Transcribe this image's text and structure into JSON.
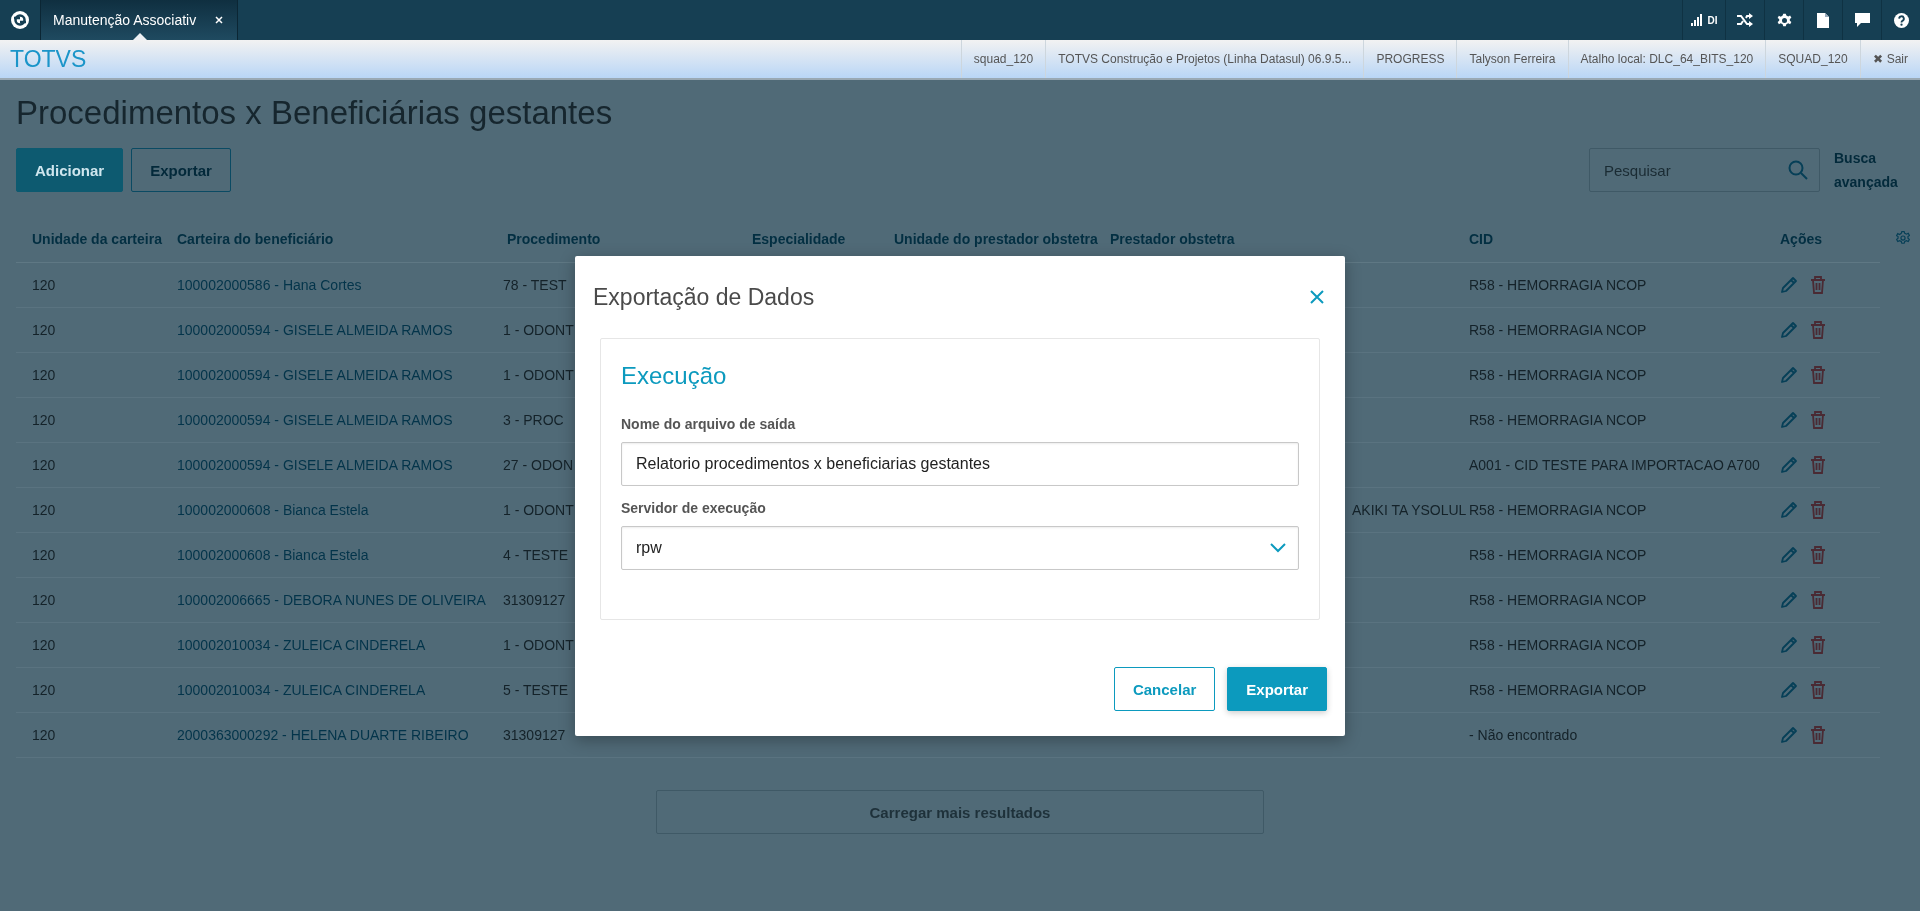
{
  "top_bar": {
    "tabs": [
      {
        "label": "Manutenção Associativ",
        "selected": true
      }
    ],
    "signal_label": "DI"
  },
  "header": {
    "brand": "TOTVS",
    "info": [
      "squad_120",
      "TOTVS Construção e Projetos (Linha Datasul) 06.9.5...",
      "PROGRESS",
      "Talyson Ferreira",
      "Atalho local: DLC_64_BITS_120",
      "SQUAD_120"
    ],
    "logout": {
      "icon": "✖",
      "label": "Sair"
    }
  },
  "page": {
    "title": "Procedimentos x Beneficiárias gestantes",
    "actions": [
      {
        "label": "Adicionar",
        "kind": "primary"
      },
      {
        "label": "Exportar",
        "kind": "secondary"
      }
    ],
    "search": {
      "placeholder": "Pesquisar"
    },
    "advanced_search": "Busca avançada"
  },
  "table": {
    "columns": [
      "Unidade da carteira",
      "Carteira do beneficiário",
      "Procedimento",
      "Especialidade",
      "Unidade do prestador obstetra",
      "Prestador obstetra",
      "CID",
      "Ações"
    ],
    "rows": [
      {
        "unidade": "120",
        "carteira": "100002000586 - Hana Cortes",
        "procedimento": "78 - TEST",
        "cid": "R58 - HEMORRAGIA NCOP"
      },
      {
        "unidade": "120",
        "carteira": "100002000594 - GISELE ALMEIDA RAMOS",
        "procedimento": "1 - ODONT",
        "cid": "R58 - HEMORRAGIA NCOP"
      },
      {
        "unidade": "120",
        "carteira": "100002000594 - GISELE ALMEIDA RAMOS",
        "procedimento": "1 - ODONT",
        "cid": "R58 - HEMORRAGIA NCOP"
      },
      {
        "unidade": "120",
        "carteira": "100002000594 - GISELE ALMEIDA RAMOS",
        "procedimento": "3 - PROC",
        "cid": "R58 - HEMORRAGIA NCOP"
      },
      {
        "unidade": "120",
        "carteira": "100002000594 - GISELE ALMEIDA RAMOS",
        "procedimento": "27 - ODON",
        "cid": "A001 - CID TESTE PARA IMPORTACAO A700"
      },
      {
        "unidade": "120",
        "carteira": "100002000608 - Bianca Estela",
        "procedimento": "1 - ODONT",
        "prestador": "AKIKI TA YSOLUL",
        "cid": "R58 - HEMORRAGIA NCOP"
      },
      {
        "unidade": "120",
        "carteira": "100002000608 - Bianca Estela",
        "procedimento": "4 - TESTE",
        "cid": "R58 - HEMORRAGIA NCOP"
      },
      {
        "unidade": "120",
        "carteira": "100002006665 - DEBORA NUNES DE OLIVEIRA",
        "procedimento": "31309127",
        "cid": "R58 - HEMORRAGIA NCOP"
      },
      {
        "unidade": "120",
        "carteira": "100002010034 - ZULEICA CINDERELA",
        "procedimento": "1 - ODONT",
        "cid": "R58 - HEMORRAGIA NCOP"
      },
      {
        "unidade": "120",
        "carteira": "100002010034 - ZULEICA CINDERELA",
        "procedimento": "5 - TESTE",
        "cid": "R58 - HEMORRAGIA NCOP"
      },
      {
        "unidade": "120",
        "carteira": "2000363000292 - HELENA DUARTE RIBEIRO",
        "procedimento": "31309127",
        "cid": "- Não encontrado"
      }
    ],
    "load_more": "Carregar mais resultados"
  },
  "modal": {
    "title": "Exportação de Dados",
    "section": "Execução",
    "fields": [
      {
        "label": "Nome do arquivo de saída",
        "value": "Relatorio procedimentos x beneficiarias gestantes",
        "kind": "text"
      },
      {
        "label": "Servidor de execução",
        "value": "rpw",
        "kind": "select"
      }
    ],
    "buttons": [
      {
        "label": "Cancelar",
        "kind": "secondary"
      },
      {
        "label": "Exportar",
        "kind": "primary"
      }
    ]
  }
}
